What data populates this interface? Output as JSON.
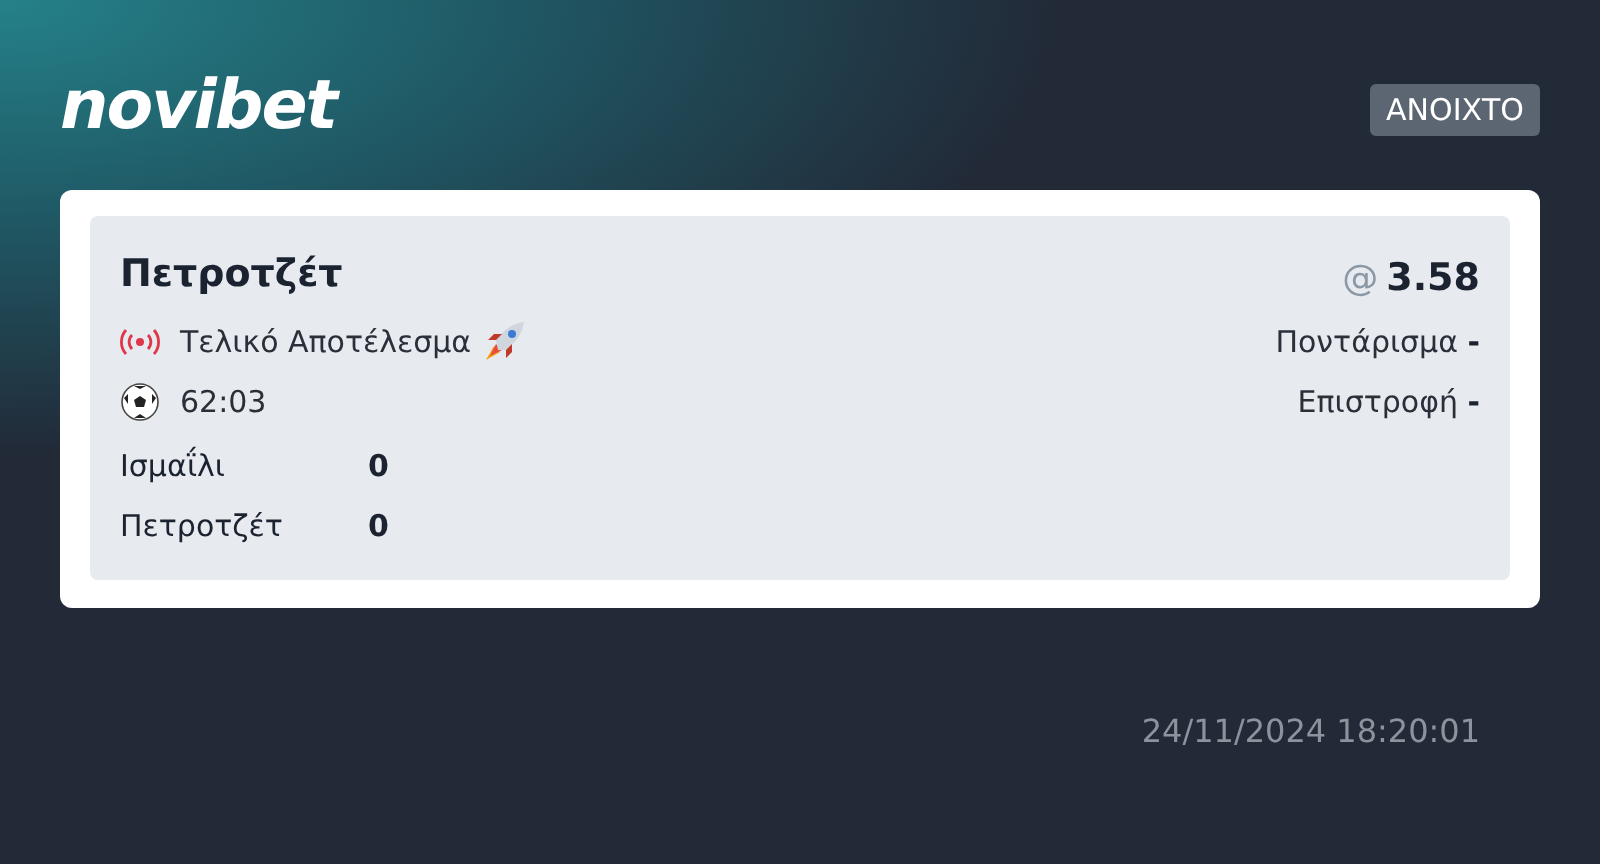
{
  "brand": "novibet",
  "status": "ΑΝΟΙΧΤΟ",
  "bet": {
    "selection": "Πετροτζέτ",
    "odds_prefix": "@",
    "odds": "3.58",
    "market": "Τελικό Αποτέλεσμα",
    "time": "62:03",
    "details": [
      "Ποντάρισμα **-**",
      "Επιστροφή **-**"
    ],
    "scores": [
      {
        "team": "Ισμαΐλι",
        "score": "0"
      },
      {
        "team": "Πετροτζέτ",
        "score": "0"
      }
    ]
  },
  "timestamp": "24/11/2024 18:20:01"
}
